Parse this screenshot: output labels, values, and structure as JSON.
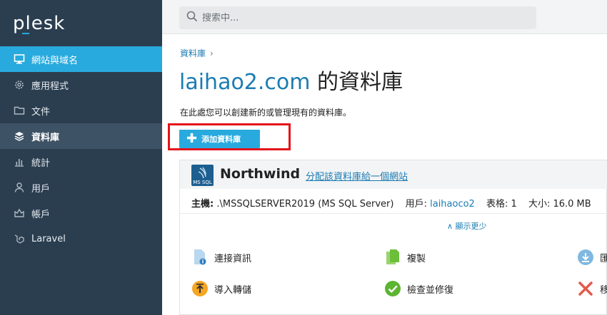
{
  "app": {
    "logo": "plesk"
  },
  "sidebar": {
    "items": [
      {
        "label": "網站與域名",
        "icon": "monitor-icon"
      },
      {
        "label": "應用程式",
        "icon": "gear-icon"
      },
      {
        "label": "文件",
        "icon": "folder-icon"
      },
      {
        "label": "資料庫",
        "icon": "database-icon"
      },
      {
        "label": "統計",
        "icon": "bar-chart-icon"
      },
      {
        "label": "用戶",
        "icon": "user-icon"
      },
      {
        "label": "帳戶",
        "icon": "account-icon"
      },
      {
        "label": "Laravel",
        "icon": "laravel-icon"
      }
    ],
    "collapse_glyph": "‹"
  },
  "search": {
    "placeholder": "搜索中..."
  },
  "breadcrumb": {
    "item": "資料庫",
    "separator": "›"
  },
  "page": {
    "title_domain": "laihao2.com",
    "title_suffix": " 的資料庫",
    "description": "在此處您可以創建新的或管理現有的資料庫。"
  },
  "toolbar": {
    "add_db_label": "添加資料庫",
    "add_db_glyph": "✚"
  },
  "database": {
    "name": "Northwind",
    "icon_label": "MS SQL",
    "assign_link": "分配該資料庫給一個網站",
    "host_label": "主機:",
    "host_value": ".\\MSSQLSERVER2019 (MS SQL Server)",
    "user_label": "用戶:",
    "user_value": "laihaoco2",
    "tables_label": "表格:",
    "tables_value": "1",
    "size_label": "大小:",
    "size_value": "16.0 MB",
    "show_less": "∧ 顯示更少"
  },
  "actions": [
    {
      "label": "連接資訊",
      "icon": "connection-info-icon"
    },
    {
      "label": "複製",
      "icon": "copy-icon"
    },
    {
      "label": "匯",
      "icon": "export-icon"
    },
    {
      "label": "導入轉儲",
      "icon": "import-dump-icon"
    },
    {
      "label": "檢查並修復",
      "icon": "check-repair-icon"
    },
    {
      "label": "移",
      "icon": "remove-icon"
    }
  ],
  "colors": {
    "accent": "#28aade",
    "sidebar": "#2b3e50",
    "link": "#1b7cb3",
    "highlight": "#e4141b"
  }
}
